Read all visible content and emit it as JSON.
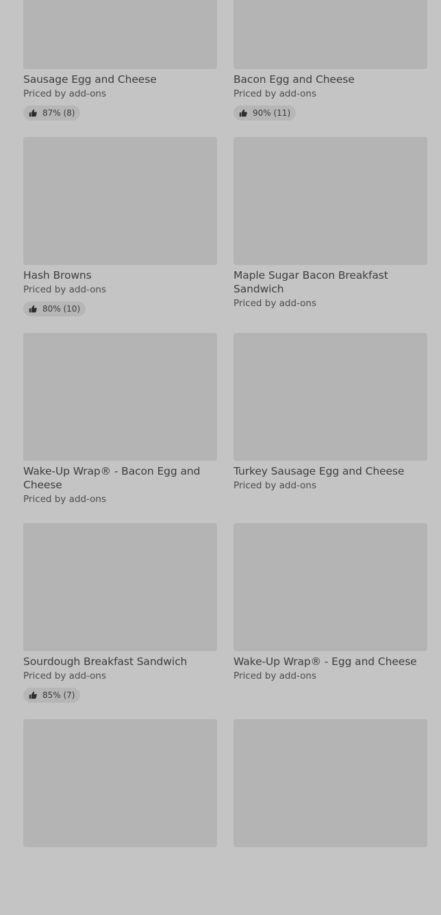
{
  "items": [
    {
      "name": "Sausage Egg and Cheese",
      "price": "Priced by add-ons",
      "rating": "87% (8)"
    },
    {
      "name": "Bacon Egg and Cheese",
      "price": "Priced by add-ons",
      "rating": "90% (11)"
    },
    {
      "name": "Hash Browns",
      "price": "Priced by add-ons",
      "rating": "80% (10)"
    },
    {
      "name": "Maple Sugar Bacon Breakfast Sandwich",
      "price": "Priced by add-ons",
      "rating": null
    },
    {
      "name": "Wake-Up Wrap® - Bacon Egg and Cheese",
      "price": "Priced by add-ons",
      "rating": null
    },
    {
      "name": "Turkey Sausage Egg and Cheese",
      "price": "Priced by add-ons",
      "rating": null
    },
    {
      "name": "Sourdough Breakfast Sandwich",
      "price": "Priced by add-ons",
      "rating": "85% (7)"
    },
    {
      "name": "Wake-Up Wrap® - Egg and Cheese",
      "price": "Priced by add-ons",
      "rating": null
    },
    {
      "name": "",
      "price": "",
      "rating": null
    },
    {
      "name": "",
      "price": "",
      "rating": null
    }
  ],
  "icons": {
    "rating": "thumbs-up-icon"
  },
  "colors": {
    "background": "#c4c4c4",
    "thumbnail": "#b4b4b4",
    "rating_pill": "#b6b6b6"
  }
}
